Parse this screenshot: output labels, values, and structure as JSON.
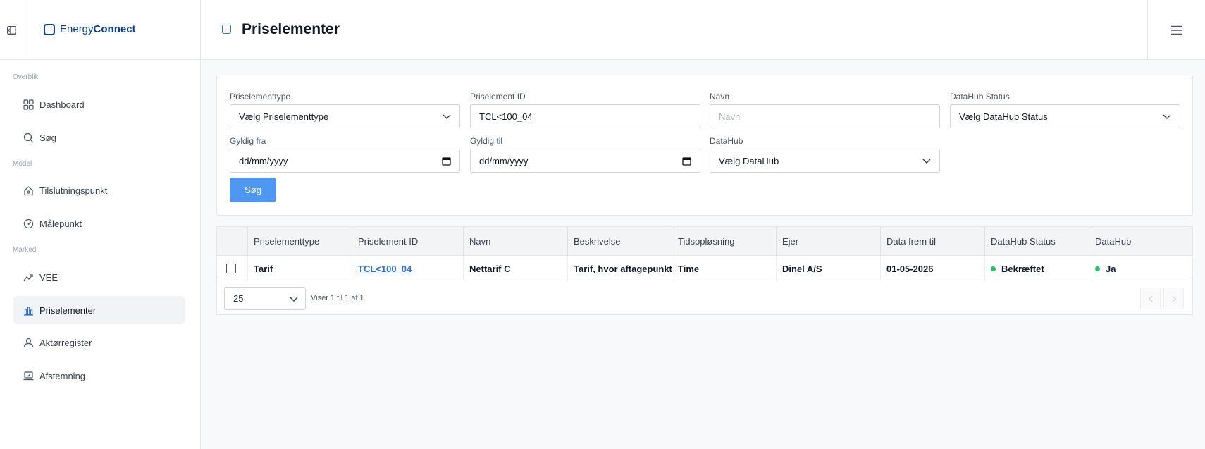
{
  "app": {
    "brand_light": "Energy",
    "brand_bold": "Connect"
  },
  "sidebar": {
    "sections": [
      {
        "label": "Overblik"
      },
      {
        "label": "Model"
      },
      {
        "label": "Marked"
      }
    ],
    "items": [
      {
        "label": "Dashboard",
        "icon": "grid-icon"
      },
      {
        "label": "Søg",
        "icon": "search-icon"
      },
      {
        "label": "Tilslutningspunkt",
        "icon": "house-icon"
      },
      {
        "label": "Målepunkt",
        "icon": "gauge-icon"
      },
      {
        "label": "VEE",
        "icon": "trend-icon"
      },
      {
        "label": "Priselementer",
        "icon": "chart-bars-icon",
        "active": true
      },
      {
        "label": "Aktørregister",
        "icon": "user-icon"
      },
      {
        "label": "Afstemning",
        "icon": "laptop-check-icon"
      }
    ]
  },
  "header": {
    "title": "Priselementer"
  },
  "filters": {
    "type_label": "Priselementtype",
    "type_value": "Vælg Priselementtype",
    "id_label": "Priselement ID",
    "id_value": "TCL<100_04",
    "name_label": "Navn",
    "name_placeholder": "Navn",
    "status_label": "DataHub Status",
    "status_value": "Vælg DataHub Status",
    "from_label": "Gyldig fra",
    "from_value": "dd/mm/yyyy",
    "to_label": "Gyldig til",
    "to_value": "dd/mm/yyyy",
    "datahub_label": "DataHub",
    "datahub_value": "Vælg DataHub",
    "search_label": "Søg"
  },
  "table": {
    "columns": [
      "Priselementtype",
      "Priselement ID",
      "Navn",
      "Beskrivelse",
      "Tidsopløsning",
      "Ejer",
      "Data frem til",
      "DataHub Status",
      "DataHub"
    ],
    "rows": [
      {
        "type": "Tarif",
        "id": "TCL<100_04",
        "name": "Nettarif C",
        "description": "Tarif, hvor aftagepunktet",
        "resolution": "Time",
        "owner": "Dinel A/S",
        "data_until": "01-05-2026",
        "status": "Bekræftet",
        "datahub": "Ja"
      }
    ],
    "status_color": "#22c55e"
  },
  "pager": {
    "page_size": "25",
    "info": "Viser 1 til 1 af 1"
  },
  "colors": {
    "accent": "#4f97f0",
    "brand": "#0b3d91",
    "link": "#2f6fd6"
  }
}
